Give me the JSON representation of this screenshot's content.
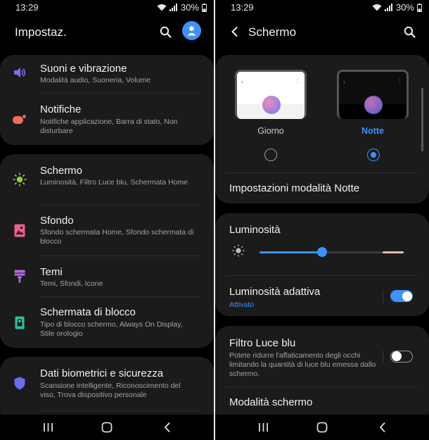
{
  "left": {
    "status": {
      "time": "13:29",
      "battery": "30%"
    },
    "header": {
      "title": "Impostaz."
    },
    "items": [
      {
        "title": "Suoni e vibrazione",
        "subtitle": "Modalità audio, Suoneria, Volume",
        "icon": "speaker-icon",
        "color": "#7b6cf2"
      },
      {
        "title": "Notifiche",
        "subtitle": "Notifiche applicazione, Barra di stato, Non disturbare",
        "icon": "notification-icon",
        "color": "#f26b5b"
      },
      {
        "title": "Schermo",
        "subtitle": "Luminosità, Filtro Luce blu, Schermata Home",
        "icon": "sun-icon",
        "color": "#8bd62d"
      },
      {
        "title": "Sfondo",
        "subtitle": "Sfondo schermata Home, Sfondo schermata di blocco",
        "icon": "image-icon",
        "color": "#ee5d8c"
      },
      {
        "title": "Temi",
        "subtitle": "Temi, Sfondi, Icone",
        "icon": "brush-icon",
        "color": "#b567e8"
      },
      {
        "title": "Schermata di blocco",
        "subtitle": "Tipo di blocco schermo, Always On Display, Stile orologio",
        "icon": "lock-icon",
        "color": "#2fbf9b"
      },
      {
        "title": "Dati biometrici e sicurezza",
        "subtitle": "Scansione intelligente, Riconoscimento del viso, Trova dispositivo personale",
        "icon": "shield-icon",
        "color": "#6b6cf2"
      }
    ]
  },
  "right": {
    "status": {
      "time": "13:29",
      "battery": "30%"
    },
    "header": {
      "title": "Schermo"
    },
    "mode": {
      "day_label": "Giorno",
      "night_label": "Notte",
      "selected": "night"
    },
    "night_settings_label": "Impostazioni modalità Notte",
    "brightness": {
      "label": "Luminosità",
      "level": 0.43
    },
    "adaptive": {
      "label": "Luminosità adattiva",
      "status": "Attivato",
      "on": true
    },
    "blue_filter": {
      "label": "Filtro Luce blu",
      "desc": "Potete ridurre l'affaticamento degli occhi limitando la quantità di luce blu emessa dallo schermo.",
      "on": false
    },
    "screen_mode_label": "Modalità schermo"
  },
  "colors": {
    "accent": "#3e91ff",
    "card": "#1b1b1b"
  }
}
